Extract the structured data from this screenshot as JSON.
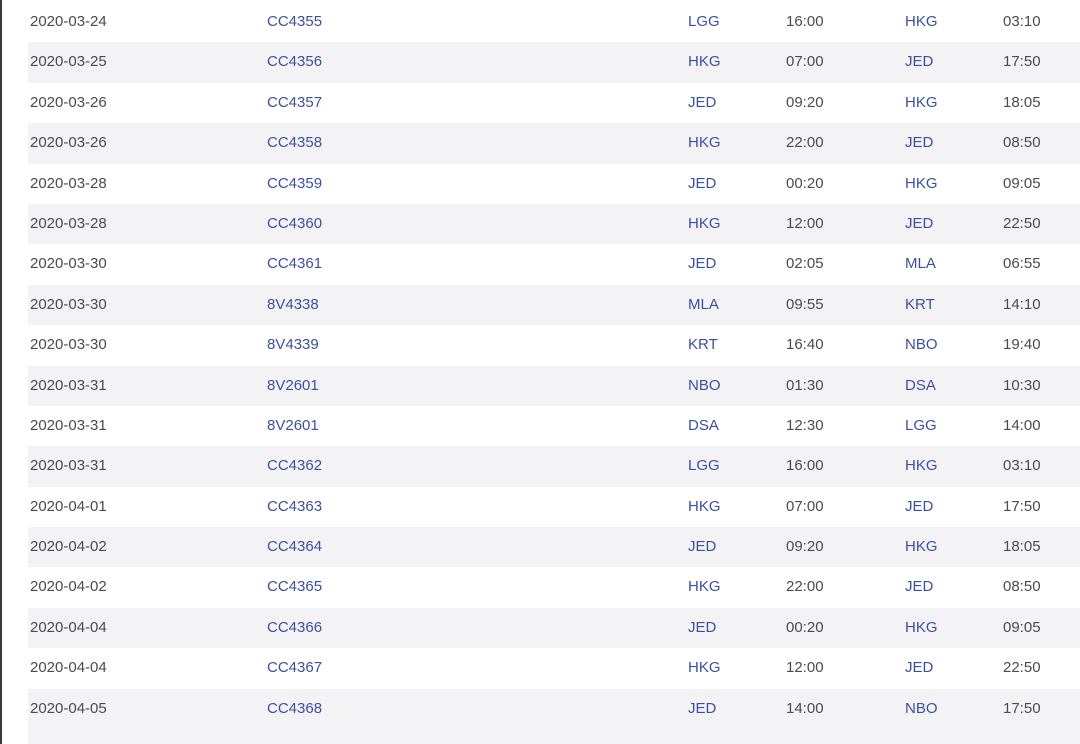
{
  "flights": {
    "rows": [
      {
        "date": "2020-03-24",
        "flight": "CC4355",
        "from": "LGG",
        "departure": "16:00",
        "to": "HKG",
        "arrival": "03:10"
      },
      {
        "date": "2020-03-25",
        "flight": "CC4356",
        "from": "HKG",
        "departure": "07:00",
        "to": "JED",
        "arrival": "17:50"
      },
      {
        "date": "2020-03-26",
        "flight": "CC4357",
        "from": "JED",
        "departure": "09:20",
        "to": "HKG",
        "arrival": "18:05"
      },
      {
        "date": "2020-03-26",
        "flight": "CC4358",
        "from": "HKG",
        "departure": "22:00",
        "to": "JED",
        "arrival": "08:50"
      },
      {
        "date": "2020-03-28",
        "flight": "CC4359",
        "from": "JED",
        "departure": "00:20",
        "to": "HKG",
        "arrival": "09:05"
      },
      {
        "date": "2020-03-28",
        "flight": "CC4360",
        "from": "HKG",
        "departure": "12:00",
        "to": "JED",
        "arrival": "22:50"
      },
      {
        "date": "2020-03-30",
        "flight": "CC4361",
        "from": "JED",
        "departure": "02:05",
        "to": "MLA",
        "arrival": "06:55"
      },
      {
        "date": "2020-03-30",
        "flight": "8V4338",
        "from": "MLA",
        "departure": "09:55",
        "to": "KRT",
        "arrival": "14:10"
      },
      {
        "date": "2020-03-30",
        "flight": "8V4339",
        "from": "KRT",
        "departure": "16:40",
        "to": "NBO",
        "arrival": "19:40"
      },
      {
        "date": "2020-03-31",
        "flight": "8V2601",
        "from": "NBO",
        "departure": "01:30",
        "to": "DSA",
        "arrival": "10:30"
      },
      {
        "date": "2020-03-31",
        "flight": "8V2601",
        "from": "DSA",
        "departure": "12:30",
        "to": "LGG",
        "arrival": "14:00"
      },
      {
        "date": "2020-03-31",
        "flight": "CC4362",
        "from": "LGG",
        "departure": "16:00",
        "to": "HKG",
        "arrival": "03:10"
      },
      {
        "date": "2020-04-01",
        "flight": "CC4363",
        "from": "HKG",
        "departure": "07:00",
        "to": "JED",
        "arrival": "17:50"
      },
      {
        "date": "2020-04-02",
        "flight": "CC4364",
        "from": "JED",
        "departure": "09:20",
        "to": "HKG",
        "arrival": "18:05"
      },
      {
        "date": "2020-04-02",
        "flight": "CC4365",
        "from": "HKG",
        "departure": "22:00",
        "to": "JED",
        "arrival": "08:50"
      },
      {
        "date": "2020-04-04",
        "flight": "CC4366",
        "from": "JED",
        "departure": "00:20",
        "to": "HKG",
        "arrival": "09:05"
      },
      {
        "date": "2020-04-04",
        "flight": "CC4367",
        "from": "HKG",
        "departure": "12:00",
        "to": "JED",
        "arrival": "22:50"
      },
      {
        "date": "2020-04-05",
        "flight": "CC4368",
        "from": "JED",
        "departure": "14:00",
        "to": "NBO",
        "arrival": "17:50"
      }
    ]
  }
}
